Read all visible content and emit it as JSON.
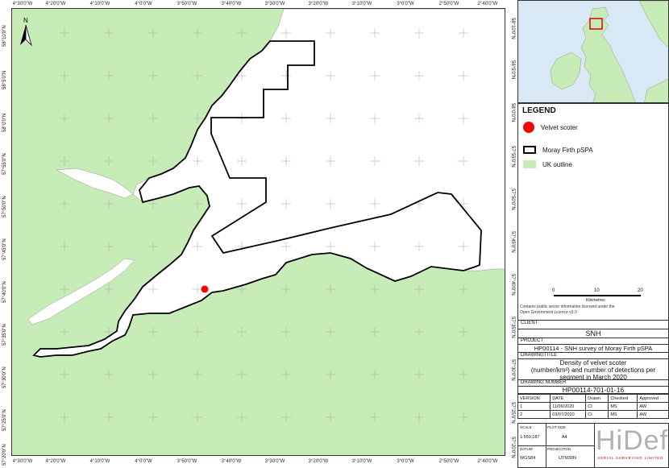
{
  "map": {
    "top_lon_ticks": [
      "4°30'0\"W",
      "4°20'0\"W",
      "4°10'0\"W",
      "4°0'0\"W",
      "3°50'0\"W",
      "3°40'0\"W",
      "3°30'0\"W",
      "3°20'0\"W",
      "3°10'0\"W",
      "3°0'0\"W",
      "2°50'0\"W",
      "2°40'0\"W"
    ],
    "bottom_lon_ticks": [
      "4°30'0\"W",
      "4°20'0\"W",
      "4°10'0\"W",
      "4°0'0\"W",
      "3°50'0\"W",
      "3°40'0\"W",
      "3°30'0\"W",
      "3°20'0\"W",
      "3°10'0\"W",
      "3°0'0\"W",
      "2°50'0\"W",
      "2°40'0\"W"
    ],
    "lat_ticks": [
      "58°10'0\"N",
      "58°5'0\"N",
      "58°0'0\"N",
      "57°55'0\"N",
      "57°50'0\"N",
      "57°45'0\"N",
      "57°40'0\"N",
      "57°35'0\"N",
      "57°30'0\"N",
      "57°25'0\"N",
      "57°20'0\"N"
    ],
    "north_label": "N",
    "colors": {
      "land": "#c7ecb7",
      "sea": "#ffffff",
      "boundary": "#000000",
      "point": "#ff0000"
    },
    "detections": [
      {
        "species": "Velvet scoter",
        "lat": "57°38'N",
        "lon": "3°49'W"
      }
    ]
  },
  "legend": {
    "title": "LEGEND",
    "items": [
      {
        "label": "Velvet scoter",
        "symbol": "red-circle",
        "color": "#ff0000"
      },
      {
        "label": "Moray Firth pSPA",
        "symbol": "black-outline",
        "color": "#000000"
      },
      {
        "label": "UK outline",
        "symbol": "green-fill",
        "color": "#c7ecb7"
      }
    ],
    "scalebar": {
      "labels": [
        "0",
        "10",
        "20"
      ],
      "unit": "Kilometres"
    },
    "notes": [
      "Contains public sector information licensed under the",
      "Open Government Licence v3.0"
    ]
  },
  "title_block": {
    "client_label": "CLIENT",
    "client": "SNH",
    "project_label": "PROJECT",
    "project": "HP00114 - SNH survey of Moray Firth pSPA",
    "drawing_title_label": "DRAWINGTITLE",
    "drawing_title": [
      "Density of velvet scoter",
      "(number/km²) and number of detections per",
      "segment in March 2020"
    ],
    "drawing_number_label": "DRAWING NUMBER",
    "drawing_number": "HP00114-701-01-16",
    "versions_header": [
      "VERSION",
      "DATE",
      "Drawn",
      "Checked",
      "Approved"
    ],
    "versions": [
      [
        "1",
        "11/06/2020",
        "CI",
        "MS",
        "AW"
      ],
      [
        "2",
        "03/07/2020",
        "CI",
        "MS",
        "AW"
      ]
    ],
    "scale_label": "SCALE",
    "scale": "1:550,187",
    "plot_size_label": "PLOT SIZE",
    "plot_size": "A4",
    "datum_label": "DATUM",
    "datum": "WGS84",
    "projection_label": "PROJECTION",
    "projection": "UTM30N",
    "logo_text": "HiDef",
    "logo_subtitle": "AERIAL SURVEYING LIMITED"
  }
}
